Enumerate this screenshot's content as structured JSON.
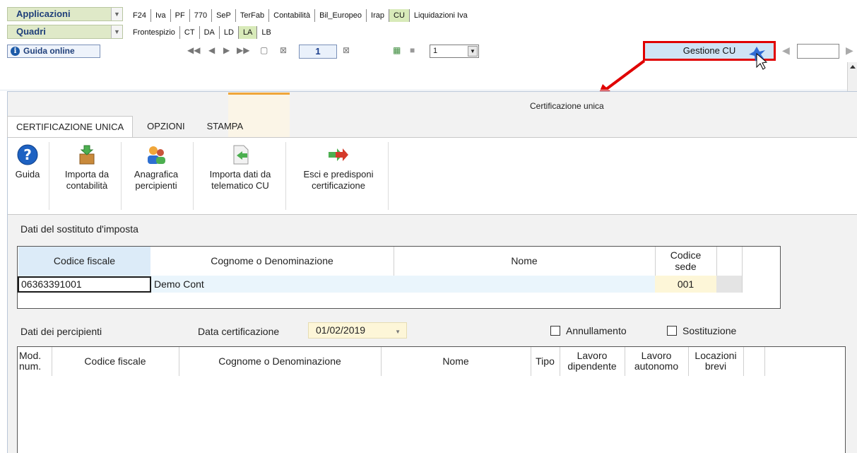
{
  "top": {
    "applicazioni": "Applicazioni",
    "quadri": "Quadri",
    "menu1": [
      "F24",
      "Iva",
      "PF",
      "770",
      "SeP",
      "TerFab",
      "Contabilità",
      "Bil_Europeo",
      "Irap",
      "CU",
      "Liquidazioni Iva"
    ],
    "menu2": [
      "Frontespizio",
      "CT",
      "DA",
      "LD",
      "LA",
      "LB"
    ],
    "guida_online": "Guida online",
    "page_number": "1",
    "zoom_value": "1",
    "gestione_cu": "Gestione CU"
  },
  "window": {
    "title": "Certificazione unica",
    "tabs": [
      "CERTIFICAZIONE UNICA",
      "OPZIONI",
      "STAMPA"
    ]
  },
  "ribbon": {
    "guida": "Guida",
    "importa_contabilita_1": "Importa da",
    "importa_contabilita_2": "contabilità",
    "anagrafica_1": "Anagrafica",
    "anagrafica_2": "percipienti",
    "importa_telematico_1": "Importa dati da",
    "importa_telematico_2": "telematico CU",
    "esci_1": "Esci e predisponi",
    "esci_2": "certificazione"
  },
  "sostituto": {
    "section_title": "Dati del sostituto d'imposta",
    "headers": {
      "codice_fiscale": "Codice fiscale",
      "cognome": "Cognome o Denominazione",
      "nome": "Nome",
      "codice_sede_1": "Codice",
      "codice_sede_2": "sede"
    },
    "row": {
      "codice_fiscale": "06363391001",
      "cognome": "Demo Cont",
      "nome": "",
      "codice_sede": "001"
    }
  },
  "percipienti": {
    "section_title": "Dati dei percipienti",
    "data_cert_label": "Data certificazione",
    "data_cert_value": "01/02/2019",
    "annullamento": "Annullamento",
    "sostituzione": "Sostituzione",
    "headers": {
      "mod_1": "Mod.",
      "mod_2": "num.",
      "codice_fiscale": "Codice fiscale",
      "cognome": "Cognome o Denominazione",
      "nome": "Nome",
      "tipo": "Tipo",
      "dip_1": "Lavoro",
      "dip_2": "dipendente",
      "aut_1": "Lavoro",
      "aut_2": "autonomo",
      "loc_1": "Locazioni",
      "loc_2": "brevi"
    }
  }
}
